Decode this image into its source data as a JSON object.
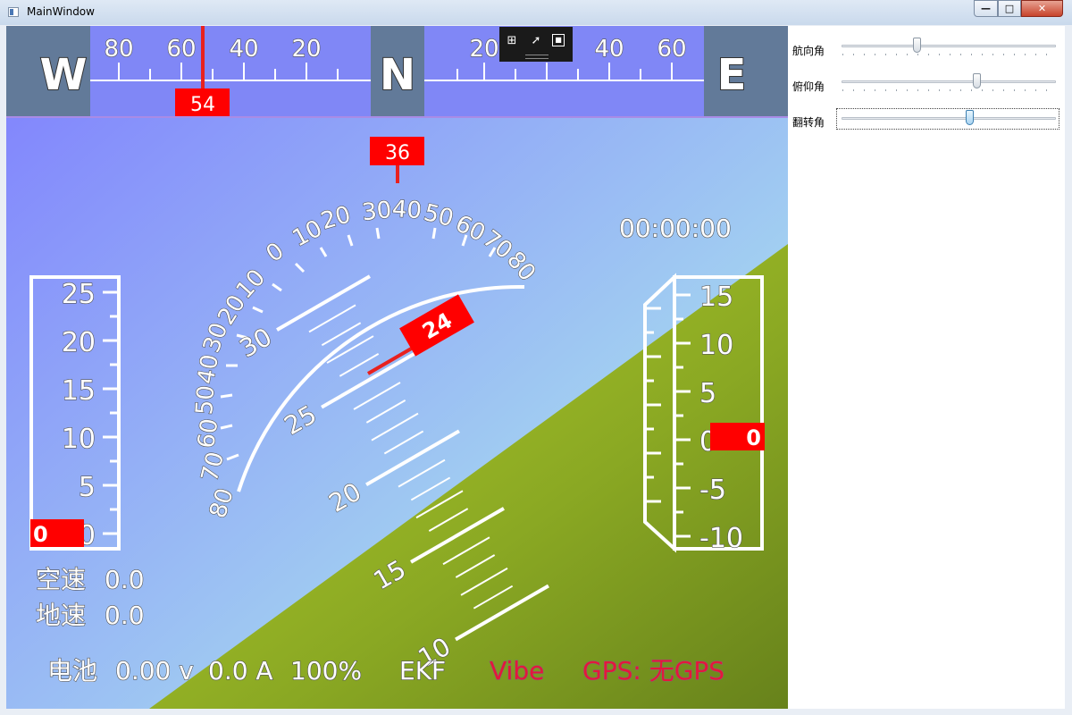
{
  "window": {
    "title": "MainWindow",
    "min": "—",
    "max": "□",
    "close": "✕"
  },
  "compass": {
    "left_cardinal": "W",
    "center_cardinal": "N",
    "right_cardinal": "E",
    "left_scale": [
      "80",
      "60",
      "40",
      "20"
    ],
    "right_scale": [
      "20",
      "40",
      "60",
      "80"
    ],
    "heading_value": "54"
  },
  "roll": {
    "value_box": "36",
    "labels_left": [
      "10",
      "0",
      "10",
      "20",
      "30",
      "40",
      "50",
      "60",
      "70",
      "80"
    ],
    "labels_right": [
      "20",
      "30",
      "40",
      "50",
      "60",
      "70",
      "80"
    ],
    "extra_left": [
      "0",
      "10",
      "20",
      "30",
      "40",
      "50",
      "60",
      "70",
      "80"
    ]
  },
  "pitch": {
    "labels": [
      "30",
      "25",
      "20",
      "15",
      "10"
    ],
    "value_box": "24"
  },
  "airspeed_tape": {
    "labels": [
      "25",
      "20",
      "15",
      "10",
      "5",
      "0"
    ],
    "value_box": "0"
  },
  "altitude_tape": {
    "labels": [
      "15",
      "10",
      "5",
      "0",
      "-5",
      "-10"
    ],
    "value_box": "0"
  },
  "clock": "00:00:00",
  "speeds": {
    "airspeed_label": "空速",
    "airspeed_value": "0.0",
    "ground_label": "地速",
    "ground_value": "0.0"
  },
  "status": {
    "battery_label": "电池",
    "voltage": "0.00 v",
    "current": "0.0 A",
    "percent": "100%",
    "ekf": "EKF",
    "vibe": "Vibe",
    "gps": "GPS: 无GPS"
  },
  "controls": {
    "heading_label": "航向角",
    "heading_value": 35,
    "pitch_label": "俯仰角",
    "pitch_value": 62,
    "roll_label": "翻转角",
    "roll_value": 60
  },
  "colors": {
    "sky_top": "#7f7ffe",
    "sky_bottom": "#a6d9ef",
    "ground": "#8fad23",
    "compass_bg": "#8087f6",
    "cardinal_bg": "#627a99",
    "marker_red": "#ff0000"
  }
}
